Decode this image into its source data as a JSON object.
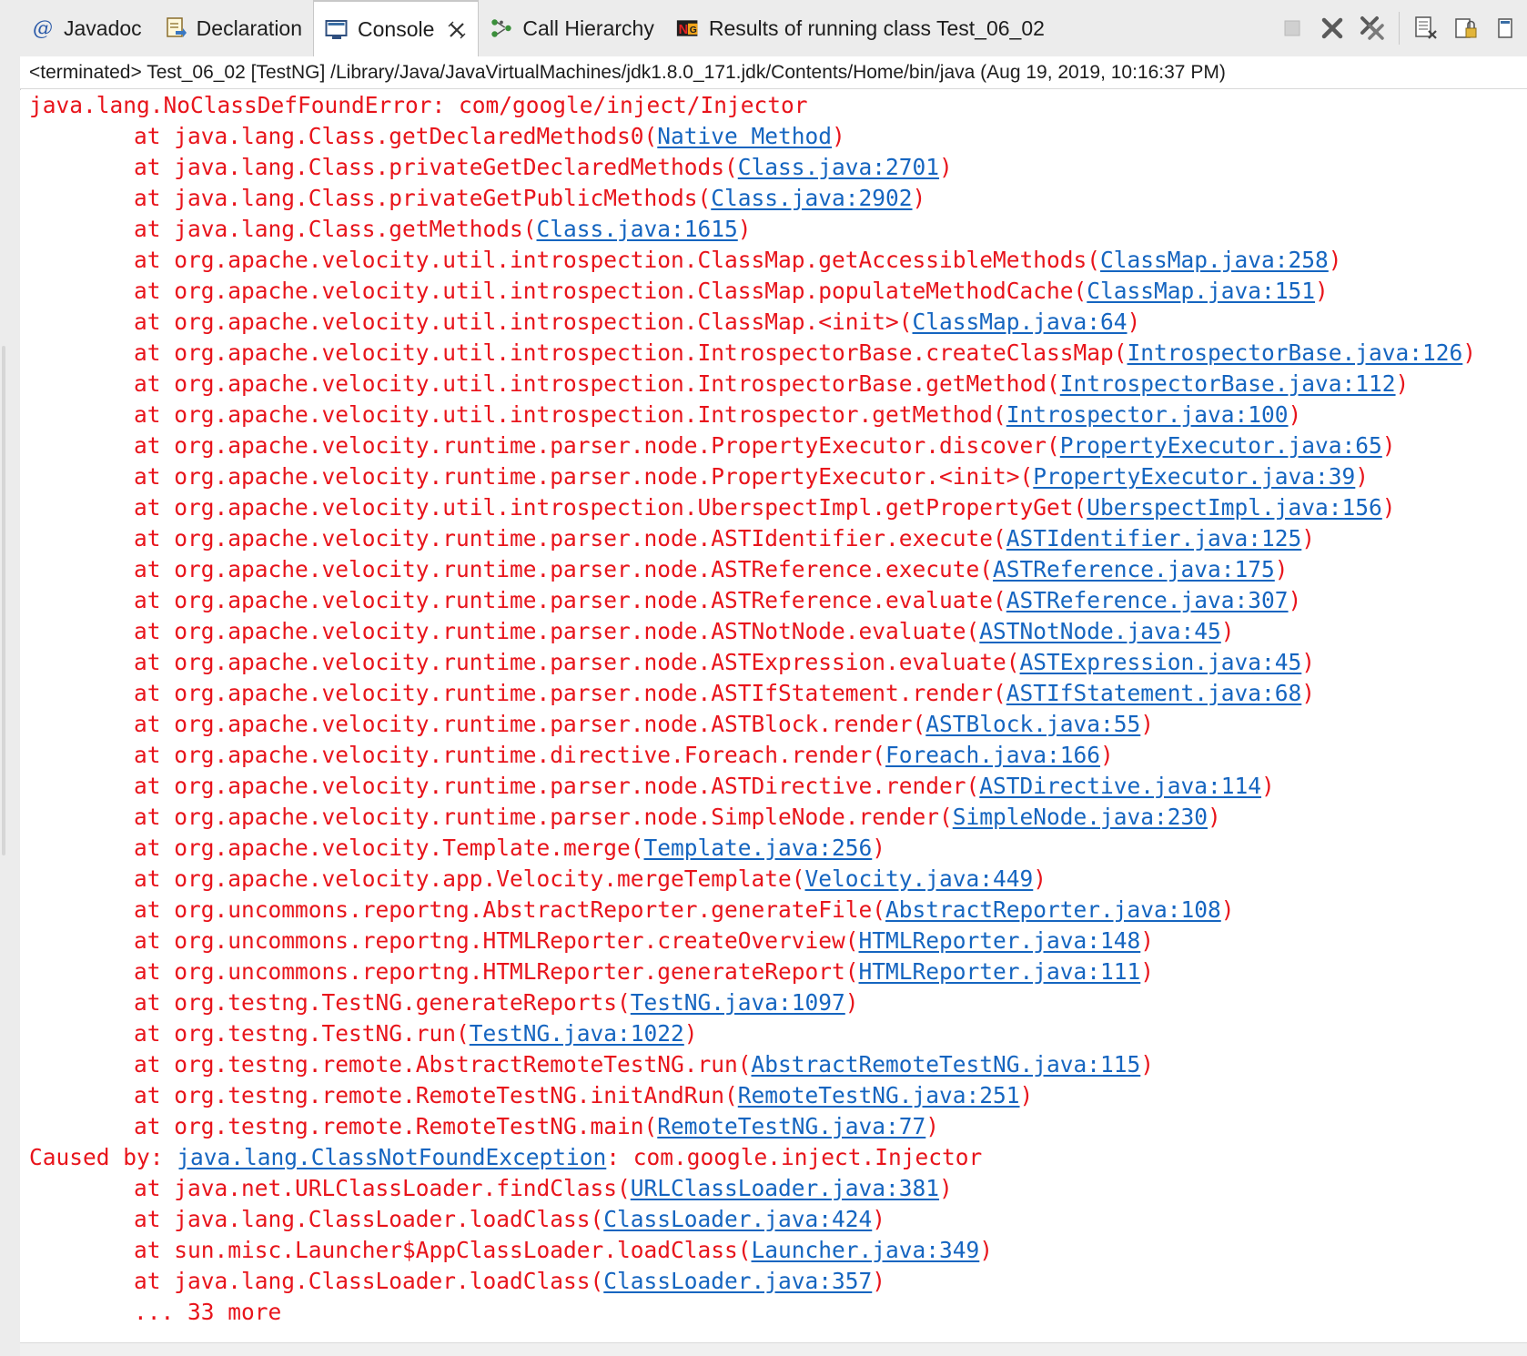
{
  "tabs": [
    {
      "label": "Javadoc",
      "icon": "at-icon"
    },
    {
      "label": "Declaration",
      "icon": "declaration-icon"
    },
    {
      "label": "Console",
      "icon": "console-icon",
      "active": true
    },
    {
      "label": "Call Hierarchy",
      "icon": "call-hierarchy-icon"
    },
    {
      "label": "Results of running class Test_06_02",
      "icon": "testng-icon"
    }
  ],
  "status_line": "<terminated> Test_06_02 [TestNG] /Library/Java/JavaVirtualMachines/jdk1.8.0_171.jdk/Contents/Home/bin/java (Aug 19, 2019, 10:16:37 PM)",
  "colors": {
    "error_text": "#e8141b",
    "link": "#1565c0"
  },
  "console": {
    "lines": [
      {
        "kind": "top",
        "pre": "java.lang.NoClassDefFoundError: com/google/inject/Injector",
        "link": "",
        "post": ""
      },
      {
        "kind": "indent",
        "pre": "at java.lang.Class.getDeclaredMethods0(",
        "link": "Native Method",
        "post": ")"
      },
      {
        "kind": "indent",
        "pre": "at java.lang.Class.privateGetDeclaredMethods(",
        "link": "Class.java:2701",
        "post": ")"
      },
      {
        "kind": "indent",
        "pre": "at java.lang.Class.privateGetPublicMethods(",
        "link": "Class.java:2902",
        "post": ")"
      },
      {
        "kind": "indent",
        "pre": "at java.lang.Class.getMethods(",
        "link": "Class.java:1615",
        "post": ")"
      },
      {
        "kind": "indent",
        "pre": "at org.apache.velocity.util.introspection.ClassMap.getAccessibleMethods(",
        "link": "ClassMap.java:258",
        "post": ")"
      },
      {
        "kind": "indent",
        "pre": "at org.apache.velocity.util.introspection.ClassMap.populateMethodCache(",
        "link": "ClassMap.java:151",
        "post": ")"
      },
      {
        "kind": "indent",
        "pre": "at org.apache.velocity.util.introspection.ClassMap.<init>(",
        "link": "ClassMap.java:64",
        "post": ")"
      },
      {
        "kind": "indent",
        "pre": "at org.apache.velocity.util.introspection.IntrospectorBase.createClassMap(",
        "link": "IntrospectorBase.java:126",
        "post": ")"
      },
      {
        "kind": "indent",
        "pre": "at org.apache.velocity.util.introspection.IntrospectorBase.getMethod(",
        "link": "IntrospectorBase.java:112",
        "post": ")"
      },
      {
        "kind": "indent",
        "pre": "at org.apache.velocity.util.introspection.Introspector.getMethod(",
        "link": "Introspector.java:100",
        "post": ")"
      },
      {
        "kind": "indent",
        "pre": "at org.apache.velocity.runtime.parser.node.PropertyExecutor.discover(",
        "link": "PropertyExecutor.java:65",
        "post": ")"
      },
      {
        "kind": "indent",
        "pre": "at org.apache.velocity.runtime.parser.node.PropertyExecutor.<init>(",
        "link": "PropertyExecutor.java:39",
        "post": ")"
      },
      {
        "kind": "indent",
        "pre": "at org.apache.velocity.util.introspection.UberspectImpl.getPropertyGet(",
        "link": "UberspectImpl.java:156",
        "post": ")"
      },
      {
        "kind": "indent",
        "pre": "at org.apache.velocity.runtime.parser.node.ASTIdentifier.execute(",
        "link": "ASTIdentifier.java:125",
        "post": ")"
      },
      {
        "kind": "indent",
        "pre": "at org.apache.velocity.runtime.parser.node.ASTReference.execute(",
        "link": "ASTReference.java:175",
        "post": ")"
      },
      {
        "kind": "indent",
        "pre": "at org.apache.velocity.runtime.parser.node.ASTReference.evaluate(",
        "link": "ASTReference.java:307",
        "post": ")"
      },
      {
        "kind": "indent",
        "pre": "at org.apache.velocity.runtime.parser.node.ASTNotNode.evaluate(",
        "link": "ASTNotNode.java:45",
        "post": ")"
      },
      {
        "kind": "indent",
        "pre": "at org.apache.velocity.runtime.parser.node.ASTExpression.evaluate(",
        "link": "ASTExpression.java:45",
        "post": ")"
      },
      {
        "kind": "indent",
        "pre": "at org.apache.velocity.runtime.parser.node.ASTIfStatement.render(",
        "link": "ASTIfStatement.java:68",
        "post": ")"
      },
      {
        "kind": "indent",
        "pre": "at org.apache.velocity.runtime.parser.node.ASTBlock.render(",
        "link": "ASTBlock.java:55",
        "post": ")"
      },
      {
        "kind": "indent",
        "pre": "at org.apache.velocity.runtime.directive.Foreach.render(",
        "link": "Foreach.java:166",
        "post": ")"
      },
      {
        "kind": "indent",
        "pre": "at org.apache.velocity.runtime.parser.node.ASTDirective.render(",
        "link": "ASTDirective.java:114",
        "post": ")"
      },
      {
        "kind": "indent",
        "pre": "at org.apache.velocity.runtime.parser.node.SimpleNode.render(",
        "link": "SimpleNode.java:230",
        "post": ")"
      },
      {
        "kind": "indent",
        "pre": "at org.apache.velocity.Template.merge(",
        "link": "Template.java:256",
        "post": ")"
      },
      {
        "kind": "indent",
        "pre": "at org.apache.velocity.app.Velocity.mergeTemplate(",
        "link": "Velocity.java:449",
        "post": ")"
      },
      {
        "kind": "indent",
        "pre": "at org.uncommons.reportng.AbstractReporter.generateFile(",
        "link": "AbstractReporter.java:108",
        "post": ")"
      },
      {
        "kind": "indent",
        "pre": "at org.uncommons.reportng.HTMLReporter.createOverview(",
        "link": "HTMLReporter.java:148",
        "post": ")"
      },
      {
        "kind": "indent",
        "pre": "at org.uncommons.reportng.HTMLReporter.generateReport(",
        "link": "HTMLReporter.java:111",
        "post": ")"
      },
      {
        "kind": "indent",
        "pre": "at org.testng.TestNG.generateReports(",
        "link": "TestNG.java:1097",
        "post": ")"
      },
      {
        "kind": "indent",
        "pre": "at org.testng.TestNG.run(",
        "link": "TestNG.java:1022",
        "post": ")"
      },
      {
        "kind": "indent",
        "pre": "at org.testng.remote.AbstractRemoteTestNG.run(",
        "link": "AbstractRemoteTestNG.java:115",
        "post": ")"
      },
      {
        "kind": "indent",
        "pre": "at org.testng.remote.RemoteTestNG.initAndRun(",
        "link": "RemoteTestNG.java:251",
        "post": ")"
      },
      {
        "kind": "indent",
        "pre": "at org.testng.remote.RemoteTestNG.main(",
        "link": "RemoteTestNG.java:77",
        "post": ")"
      },
      {
        "kind": "top",
        "pre": "Caused by: ",
        "link": "java.lang.ClassNotFoundException",
        "post": ": com.google.inject.Injector"
      },
      {
        "kind": "indent",
        "pre": "at java.net.URLClassLoader.findClass(",
        "link": "URLClassLoader.java:381",
        "post": ")"
      },
      {
        "kind": "indent",
        "pre": "at java.lang.ClassLoader.loadClass(",
        "link": "ClassLoader.java:424",
        "post": ")"
      },
      {
        "kind": "indent",
        "pre": "at sun.misc.Launcher$AppClassLoader.loadClass(",
        "link": "Launcher.java:349",
        "post": ")"
      },
      {
        "kind": "indent",
        "pre": "at java.lang.ClassLoader.loadClass(",
        "link": "ClassLoader.java:357",
        "post": ")"
      },
      {
        "kind": "indent",
        "pre": "... 33 more",
        "link": "",
        "post": ""
      }
    ]
  }
}
